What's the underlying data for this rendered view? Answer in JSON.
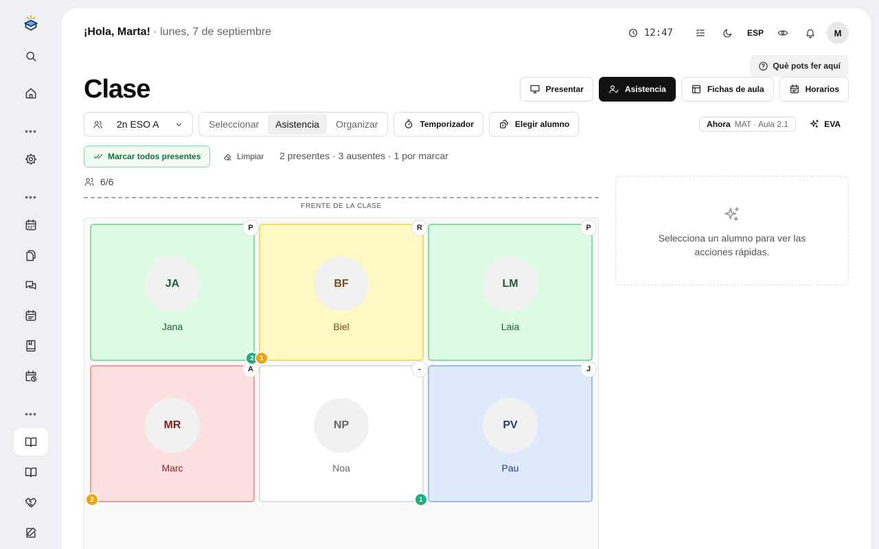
{
  "header": {
    "greeting": "¡Hola, Marta!",
    "date": " · lunes, 7 de septiembre",
    "time": "12:47",
    "language": "ESP",
    "avatar_initial": "M",
    "help_label": "Què pots fer aquí"
  },
  "page": {
    "title": "Clase"
  },
  "view_tabs": [
    {
      "label": "Presentar",
      "icon": "monitor-icon",
      "active": false
    },
    {
      "label": "Asistencia",
      "icon": "user-check-icon",
      "active": true
    },
    {
      "label": "Fichas de aula",
      "icon": "table-icon",
      "active": false
    },
    {
      "label": "Horarios",
      "icon": "calendar-icon",
      "active": false
    }
  ],
  "toolbar": {
    "class_selected": "2n ESO A",
    "modes": [
      "Seleccionar",
      "Asistencia",
      "Organizar"
    ],
    "active_mode": "Asistencia",
    "timer_label": "Temporizador",
    "pick_student_label": "Elegir alumno",
    "now_label": "Ahora",
    "now_detail": "MAT · Aula 2.1",
    "eva_label": "EVA"
  },
  "attendance": {
    "mark_all_label": "Marcar todos presentes",
    "clear_label": "Limpiar",
    "summary": "2 presentes · 3 ausentes · 1 por marcar",
    "count": "6/6"
  },
  "classroom": {
    "front_label": "FRENTE DE LA CLASE",
    "seats": [
      {
        "initials": "JA",
        "name": "Jana",
        "status": "P",
        "state": "present"
      },
      {
        "initials": "BF",
        "name": "Biel",
        "status": "R",
        "state": "late"
      },
      {
        "initials": "LM",
        "name": "Laia",
        "status": "P",
        "state": "present"
      },
      {
        "initials": "MR",
        "name": "Marc",
        "status": "A",
        "state": "absent"
      },
      {
        "initials": "NP",
        "name": "Noa",
        "status": "-",
        "state": "none"
      },
      {
        "initials": "PV",
        "name": "Pau",
        "status": "J",
        "state": "justified"
      }
    ],
    "badges": [
      {
        "value": "2",
        "color": "green"
      },
      {
        "value": "1",
        "color": "orange"
      },
      {
        "value": "2",
        "color": "orange"
      },
      {
        "value": "1",
        "color": "green"
      }
    ]
  },
  "quick_actions": {
    "empty_text": "Selecciona un alumno para ver las acciones rápidas."
  },
  "sidebar": {
    "items": [
      "logo-icon",
      "search-icon",
      "home-icon",
      "settings-icon",
      "calendar-icon",
      "files-icon",
      "messages-icon",
      "schedule-icon",
      "notebook-icon",
      "calendar-clock-icon",
      "book-open-icon",
      "book-icon",
      "handshake-icon",
      "edit-icon"
    ]
  }
}
